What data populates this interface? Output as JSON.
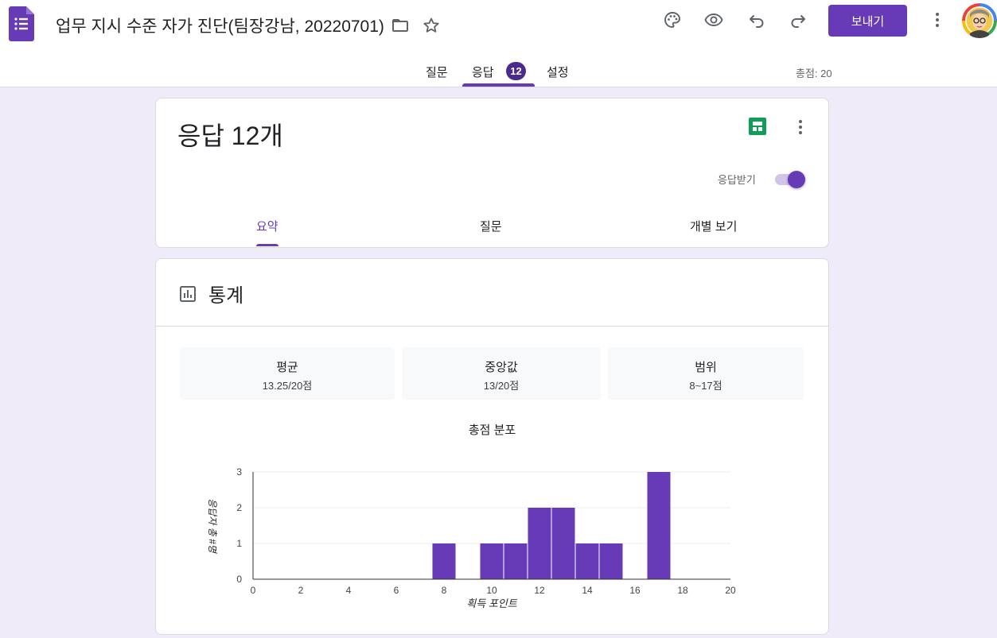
{
  "header": {
    "doc_title": "업무 지시 수준 자가 진단(팀장강남, 20220701)",
    "send_label": "보내기"
  },
  "tabs": [
    {
      "label": "질문"
    },
    {
      "label": "응답",
      "badge": "12"
    },
    {
      "label": "설정"
    }
  ],
  "total_points": "총점: 20",
  "responses_card": {
    "title": "응답 12개",
    "accept_label": "응답받기",
    "accepting": true,
    "subtabs": [
      "요약",
      "질문",
      "개별 보기"
    ]
  },
  "stats": {
    "title": "통계",
    "mean_label": "평균",
    "mean_value": "13.25/20점",
    "median_label": "중앙값",
    "median_value": "13/20점",
    "range_label": "범위",
    "range_value": "8~17점"
  },
  "colors": {
    "accent": "#673ab7",
    "background": "#f0ebf8",
    "sheets_green": "#0f9d58"
  },
  "icons": [
    "forms-logo-icon",
    "folder-icon",
    "star-icon",
    "palette-icon",
    "eye-icon",
    "undo-icon",
    "redo-icon",
    "more-vert-icon",
    "sheets-icon",
    "bar-chart-icon"
  ],
  "chart_data": {
    "type": "bar",
    "title": "총점 분포",
    "xlabel": "획득 포인트",
    "ylabel": "응답자 총 #명",
    "x": [
      8,
      10,
      11,
      12,
      13,
      14,
      15,
      17
    ],
    "values": [
      1,
      1,
      1,
      2,
      2,
      1,
      1,
      3
    ],
    "xlim": [
      0,
      20
    ],
    "ylim": [
      0,
      3
    ],
    "xticks": [
      0,
      2,
      4,
      6,
      8,
      10,
      12,
      14,
      16,
      18,
      20
    ],
    "yticks": [
      0,
      1,
      2,
      3
    ],
    "grid": true,
    "color": "#673ab7"
  }
}
